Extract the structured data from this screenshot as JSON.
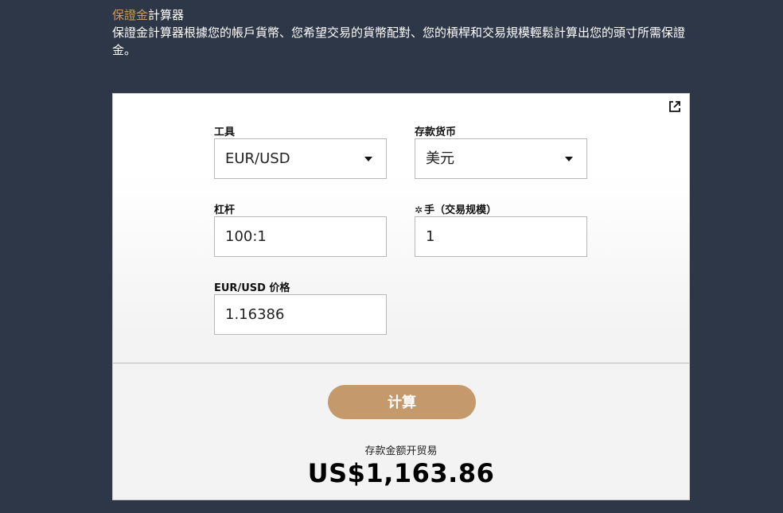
{
  "header": {
    "title_accent": "保證金",
    "title_rest": "計算器",
    "description": "保證金計算器根據您的帳戶貨幣、您希望交易的貨幣配對、您的槓桿和交易規模輕鬆計算出您的頭寸所需保證金。"
  },
  "calculator": {
    "instrument": {
      "label": "工具",
      "value": "EUR/USD"
    },
    "deposit_currency": {
      "label": "存款货币",
      "value": "美元"
    },
    "leverage": {
      "label": "杠杆",
      "value": "100:1"
    },
    "lots": {
      "label": "手（交易规模）",
      "value": "1"
    },
    "price": {
      "label": "EUR/USD 价格",
      "value": "1.16386"
    },
    "calculate_button": "计算",
    "result_label": "存款金额开贸易",
    "result_value": "US$1,163.86"
  },
  "icons": {
    "popout": "external-link-icon",
    "lots_settings": "gear-icon",
    "dropdown": "caret-down-icon"
  },
  "colors": {
    "background": "#2e3747",
    "accent": "#c49a6c"
  }
}
